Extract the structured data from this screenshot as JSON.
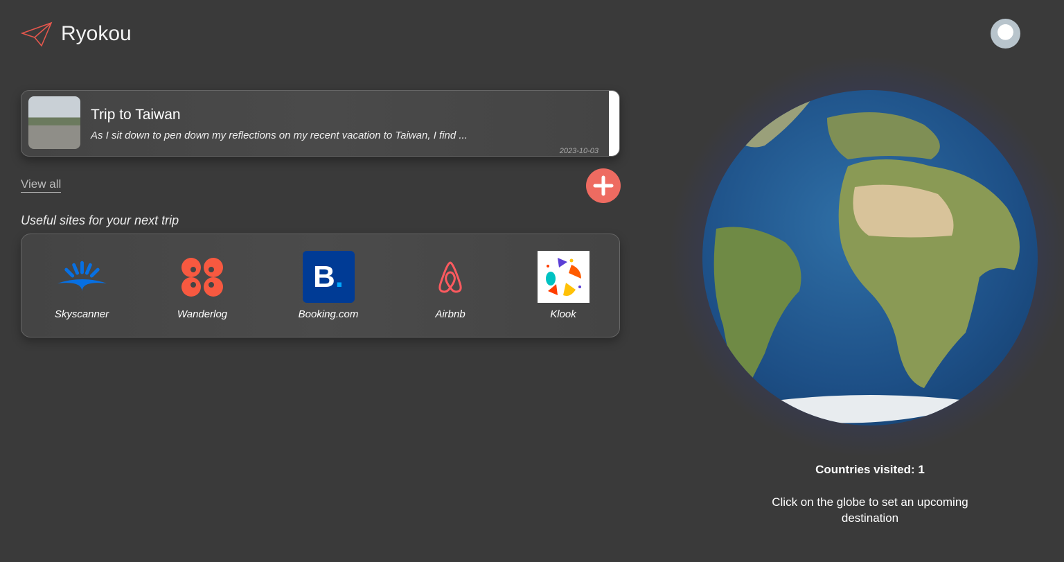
{
  "app": {
    "name": "Ryokou",
    "logo_icon": "paper-plane-icon",
    "accent": "#ee6b61"
  },
  "trip": {
    "title": "Trip to Taiwan",
    "excerpt": "As I sit down to pen down my reflections on my recent vacation to Taiwan, I find ...",
    "date": "2023-10-03"
  },
  "view_all": "View all",
  "add_icon": "plus-icon",
  "sites": {
    "label": "Useful sites for your next trip",
    "items": [
      {
        "name": "Skyscanner",
        "color": "#0770e3"
      },
      {
        "name": "Wanderlog",
        "color": "#f75940"
      },
      {
        "name": "Booking.com",
        "color": "#003b95"
      },
      {
        "name": "Airbnb",
        "color": "#ff5a5f"
      },
      {
        "name": "Klook",
        "color": "#ff5b00"
      }
    ]
  },
  "globe": {
    "countries_visited": "Countries visited: 1",
    "hint": "Click on the globe to set an upcoming destination"
  }
}
